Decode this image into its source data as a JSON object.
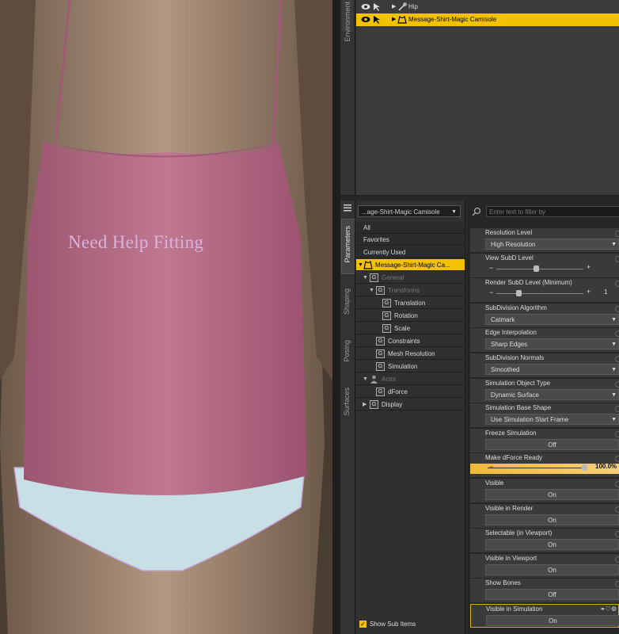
{
  "viewport": {
    "shirt_text": "Need Help Fitting"
  },
  "scene": {
    "side_tab": "Environment",
    "rows": [
      {
        "label": "Hip",
        "selected": false
      },
      {
        "label": "Message-Shirt-Magic Camisole",
        "selected": true
      }
    ]
  },
  "side_tabs": [
    "Parameters",
    "Shaping",
    "Posing",
    "Surfaces"
  ],
  "tree": {
    "node_select": "...age-Shirt-Magic Camisole",
    "filters": [
      "All",
      "Favorites",
      "Currently Used"
    ],
    "items": [
      {
        "label": "Message-Shirt-Magic Ca...",
        "selected": true
      },
      {
        "label": "General",
        "dim": true
      },
      {
        "label": "Transforms",
        "dim": true
      },
      {
        "label": "Translation"
      },
      {
        "label": "Rotation"
      },
      {
        "label": "Scale"
      },
      {
        "label": "Constraints"
      },
      {
        "label": "Mesh Resolution"
      },
      {
        "label": "Simulation"
      },
      {
        "label": "Actor",
        "dim": true
      },
      {
        "label": "dForce"
      },
      {
        "label": "Display"
      }
    ],
    "show_sub_items": "Show Sub Items"
  },
  "params": {
    "filter_placeholder": "Enter text to filter by",
    "list": [
      {
        "label": "Resolution Level",
        "kind": "select",
        "value": "High Resolution"
      },
      {
        "label": "View SubD Level",
        "kind": "slider",
        "value": "",
        "pos": 0.45
      },
      {
        "label": "Render SubD Level (Minimum)",
        "kind": "slider",
        "value": "1",
        "pos": 0.25
      },
      {
        "label": "SubDivision Algorithm",
        "kind": "select",
        "value": "Catmark"
      },
      {
        "label": "Edge Interpolation",
        "kind": "select",
        "value": "Sharp Edges"
      },
      {
        "label": "SubDivision Normals",
        "kind": "select",
        "value": "Smoothed"
      },
      {
        "label": "Simulation Object Type",
        "kind": "select",
        "value": "Dynamic Surface"
      },
      {
        "label": "Simulation Base Shape",
        "kind": "select",
        "value": "Use Simulation Start Frame"
      },
      {
        "label": "Freeze Simulation",
        "kind": "toggle",
        "value": "Off"
      },
      {
        "label": "Make dForce Ready",
        "kind": "slider-hl",
        "value": "100.0%",
        "pos": 1.0
      },
      {
        "label": "Visible",
        "kind": "toggle",
        "value": "On"
      },
      {
        "label": "Visible in Render",
        "kind": "toggle",
        "value": "On"
      },
      {
        "label": "Selectable (in Viewport)",
        "kind": "toggle",
        "value": "On"
      },
      {
        "label": "Visible in Viewport",
        "kind": "toggle",
        "value": "On"
      },
      {
        "label": "Show Bones",
        "kind": "toggle",
        "value": "Off"
      },
      {
        "label": "Visible in Simulation",
        "kind": "toggle",
        "value": "On"
      }
    ]
  },
  "colors": {
    "accent": "#f2c200",
    "shirt": "#b86a86",
    "underwear": "#c9dfe6"
  }
}
